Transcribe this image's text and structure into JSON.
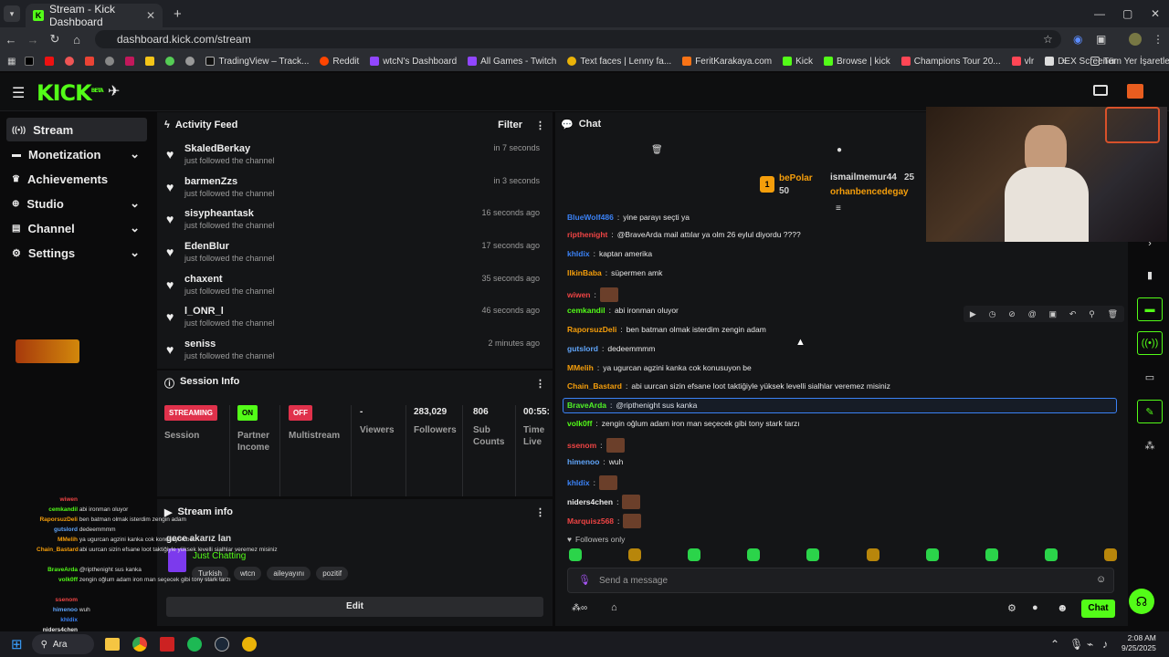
{
  "browser": {
    "tab_title": "Stream - Kick Dashboard",
    "url": "dashboard.kick.com/stream",
    "bookmarks": [
      "TradingView – Track...",
      "Reddit",
      "wtcN's Dashboard",
      "All Games - Twitch",
      "Text faces | Lenny fa...",
      "FeritKarakaya.com",
      "Kick",
      "Browse | kick",
      "Champions Tour 20...",
      "vlr",
      "DEX Screener"
    ],
    "other_bookmarks": "Tüm Yer İşaretleri"
  },
  "sidebar": {
    "items": [
      {
        "label": "Stream"
      },
      {
        "label": "Monetization"
      },
      {
        "label": "Achievements"
      },
      {
        "label": "Studio"
      },
      {
        "label": "Channel"
      },
      {
        "label": "Settings"
      }
    ]
  },
  "activity": {
    "title": "Activity Feed",
    "filter": "Filter",
    "subtitle": "just followed the channel",
    "items": [
      {
        "name": "SkaledBerkay",
        "time": "in 7 seconds"
      },
      {
        "name": "barmenZzs",
        "time": "in 3 seconds"
      },
      {
        "name": "sisypheantask",
        "time": "16 seconds ago"
      },
      {
        "name": "EdenBlur",
        "time": "17 seconds ago"
      },
      {
        "name": "chaxent",
        "time": "35 seconds ago"
      },
      {
        "name": "l_ONR_l",
        "time": "46 seconds ago"
      },
      {
        "name": "seniss",
        "time": "2 minutes ago"
      }
    ]
  },
  "session": {
    "title": "Session Info",
    "streaming": "STREAMING",
    "session_label": "Session",
    "on": "ON",
    "partner": "Partner Income",
    "off": "OFF",
    "multistream": "Multistream",
    "viewers_val": "-",
    "viewers": "Viewers",
    "followers_val": "283,029",
    "followers": "Followers",
    "subs_val": "806",
    "subs": "Sub Counts",
    "time_val": "00:55:",
    "time": "Time Live"
  },
  "streaminfo": {
    "title": "Stream info",
    "stream_title": "gece akarız lan",
    "category": "Just Chatting",
    "tags": [
      "Turkish",
      "wtcn",
      "aileyayını",
      "pozitif"
    ],
    "edit": "Edit"
  },
  "chat": {
    "title": "Chat",
    "top1": "bePolar",
    "top1_count": "50",
    "top2": "ismailmemur44",
    "top2_count": "25",
    "top3": "orhanbencedegay",
    "followers_only": "Followers only",
    "placeholder": "Send a message",
    "send": "Chat",
    "messages": [
      {
        "user": "BlueWolf486",
        "text": "yine parayı seçti ya",
        "color": "#3b82f6"
      },
      {
        "user": "ripthenight",
        "text": "@BraveArda mail attılar ya olm 26 eylul diyordu ????",
        "color": "#ef4444"
      },
      {
        "user": "khldix",
        "text": "kaptan amerika",
        "color": "#3b82f6"
      },
      {
        "user": "IlkinBaba",
        "text": "süpermen amk",
        "color": "#f59e0b"
      },
      {
        "user": "wiwen",
        "text": "",
        "color": "#ef4444"
      },
      {
        "user": "cemkandil",
        "text": "abi ironman oluyor",
        "color": "#53fc18"
      },
      {
        "user": "RaporsuzDeli",
        "text": "ben batman olmak isterdim zengin adam",
        "color": "#f59e0b"
      },
      {
        "user": "gutslord",
        "text": "dedeemmmm",
        "color": "#60a5fa"
      },
      {
        "user": "MMelih",
        "text": "ya ugurcan agzini kanka cok konusuyon be",
        "color": "#f59e0b"
      },
      {
        "user": "Chain_Bastard",
        "text": "abi uurcan sizin efsane loot taktiğiyle yüksek levelli sialhlar veremez misiniz",
        "color": "#f59e0b"
      },
      {
        "user": "BraveArda",
        "text": "@ripthenight sus kanka",
        "color": "#53fc18"
      },
      {
        "user": "volk0ff",
        "text": "zengin oğlum adam iron man seçecek gibi tony stark tarzı",
        "color": "#53fc18"
      },
      {
        "user": "ssenom",
        "text": "",
        "color": "#ef4444"
      },
      {
        "user": "himenoo",
        "text": "wuh",
        "color": "#60a5fa"
      },
      {
        "user": "khldix",
        "text": "",
        "color": "#3b82f6"
      },
      {
        "user": "niders4chen",
        "text": "",
        "color": "#e8e8e8"
      },
      {
        "user": "Marquisz568",
        "text": "",
        "color": "#ef4444"
      }
    ]
  },
  "taskbar": {
    "search": "Ara",
    "time": "2:08 AM",
    "date": "9/25/2025"
  }
}
